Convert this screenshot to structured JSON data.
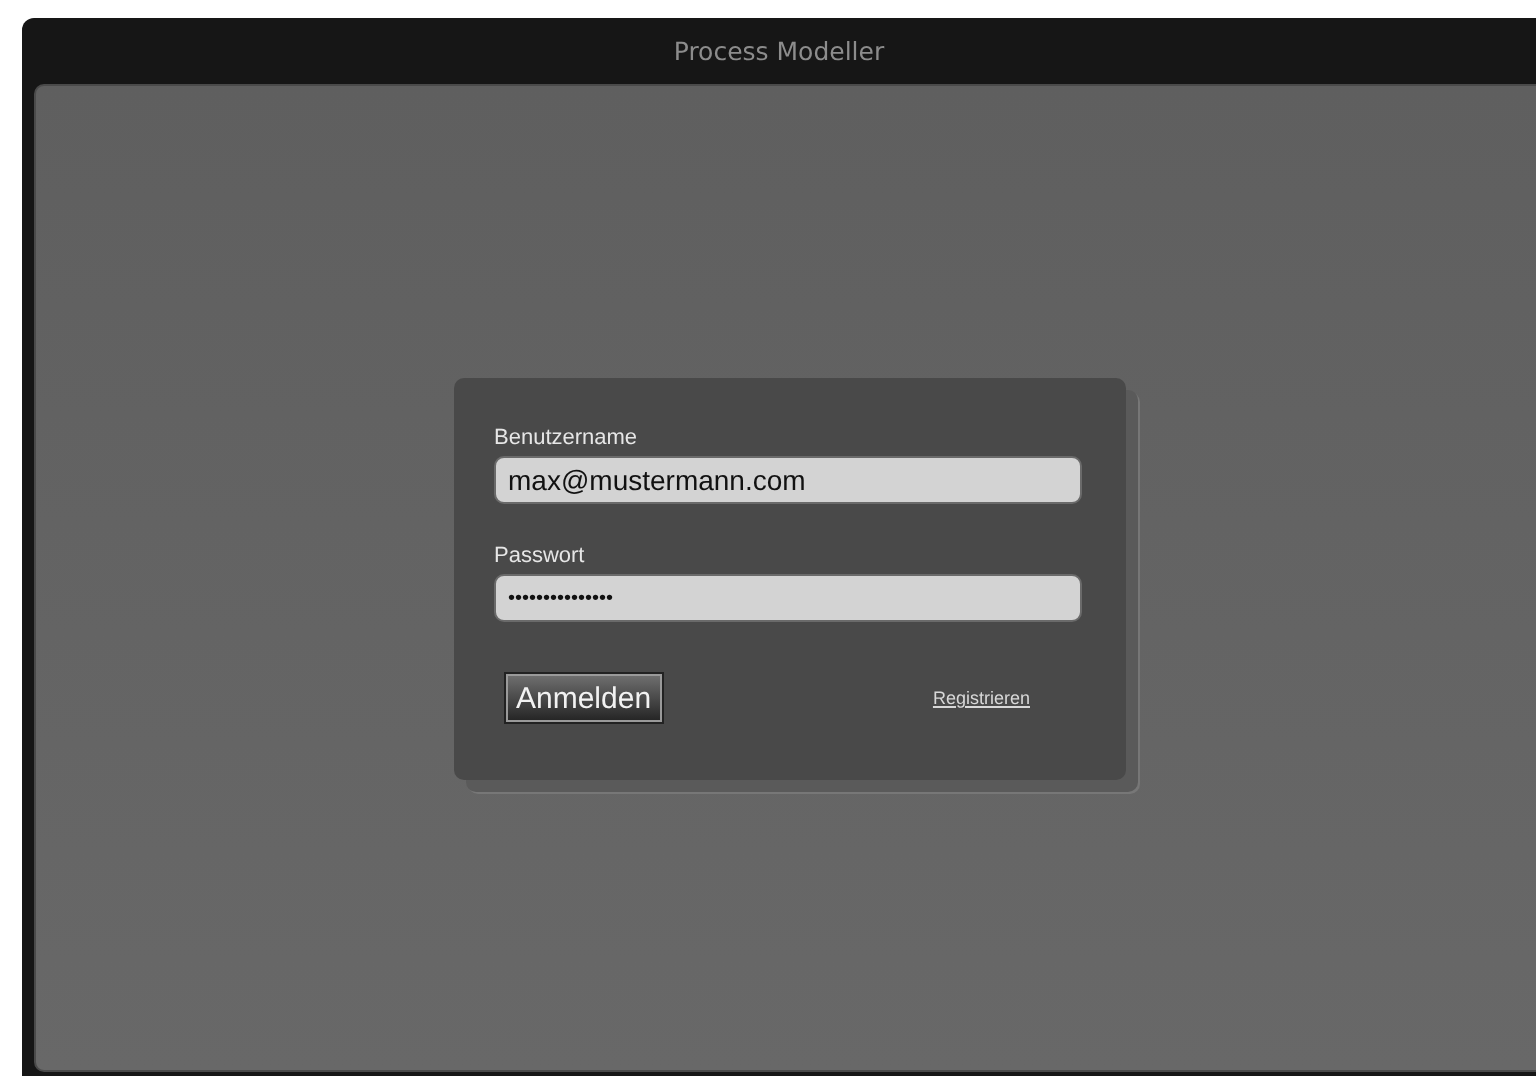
{
  "window": {
    "title": "Process Modeller"
  },
  "login": {
    "username": {
      "label": "Benutzername",
      "value": "max@mustermann.com"
    },
    "password": {
      "label": "Passwort",
      "value": "•••••••••••••••"
    },
    "submit": "Anmelden",
    "register_link": "Registrieren"
  }
}
